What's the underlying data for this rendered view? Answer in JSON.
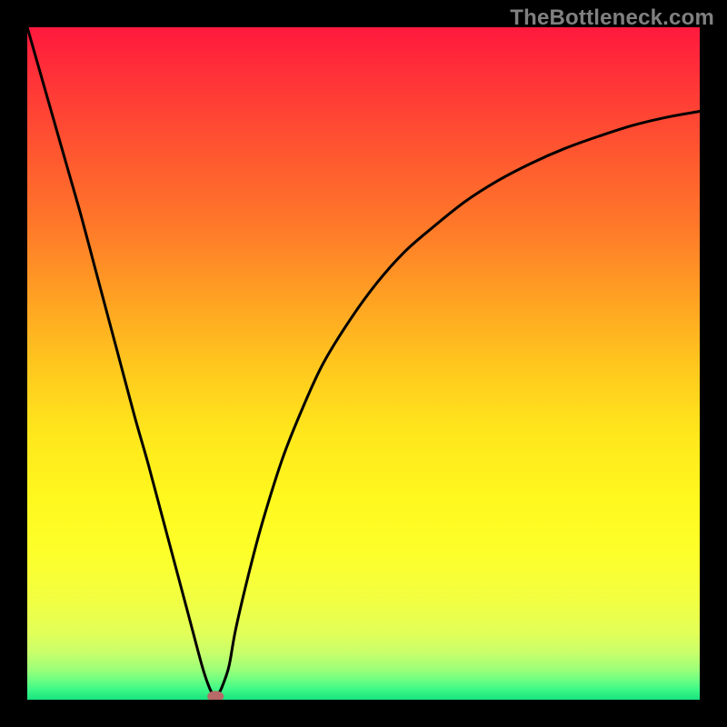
{
  "watermark": "TheBottleneck.com",
  "chart_data": {
    "type": "line",
    "title": "",
    "xlabel": "",
    "ylabel": "",
    "xlim": [
      0,
      100
    ],
    "ylim": [
      0,
      100
    ],
    "grid": false,
    "series": [
      {
        "name": "bottleneck-curve",
        "x": [
          0,
          2,
          4,
          6,
          8,
          10,
          12,
          14,
          16,
          18,
          20,
          22,
          24,
          26,
          27,
          27.5,
          28,
          28.5,
          29,
          30,
          31,
          33,
          35,
          38,
          41,
          44,
          48,
          52,
          56,
          60,
          65,
          70,
          75,
          80,
          85,
          90,
          95,
          100
        ],
        "y": [
          100,
          93,
          86,
          79,
          72,
          64.5,
          57,
          49.5,
          42,
          35,
          27.5,
          20,
          12.5,
          5,
          2,
          1,
          0.5,
          1,
          2,
          5,
          10.5,
          19,
          26.5,
          36,
          43.5,
          50,
          56.5,
          62,
          66.5,
          70,
          74,
          77.2,
          79.8,
          82,
          83.8,
          85.4,
          86.6,
          87.5
        ]
      }
    ],
    "marker": {
      "x": 28,
      "y": 0.5,
      "color": "#b76a68"
    },
    "gradient_stops": [
      {
        "offset": 0.0,
        "color": "#ff193e"
      },
      {
        "offset": 0.1,
        "color": "#ff3b36"
      },
      {
        "offset": 0.2,
        "color": "#ff5b2f"
      },
      {
        "offset": 0.3,
        "color": "#ff7a29"
      },
      {
        "offset": 0.4,
        "color": "#ffa023"
      },
      {
        "offset": 0.5,
        "color": "#ffc61e"
      },
      {
        "offset": 0.6,
        "color": "#ffe61c"
      },
      {
        "offset": 0.7,
        "color": "#fff81e"
      },
      {
        "offset": 0.78,
        "color": "#fdff2a"
      },
      {
        "offset": 0.85,
        "color": "#f2ff41"
      },
      {
        "offset": 0.9,
        "color": "#e2ff58"
      },
      {
        "offset": 0.93,
        "color": "#c8ff6a"
      },
      {
        "offset": 0.955,
        "color": "#9cff78"
      },
      {
        "offset": 0.97,
        "color": "#6fff82"
      },
      {
        "offset": 0.985,
        "color": "#3cf886"
      },
      {
        "offset": 1.0,
        "color": "#18e27f"
      }
    ]
  }
}
